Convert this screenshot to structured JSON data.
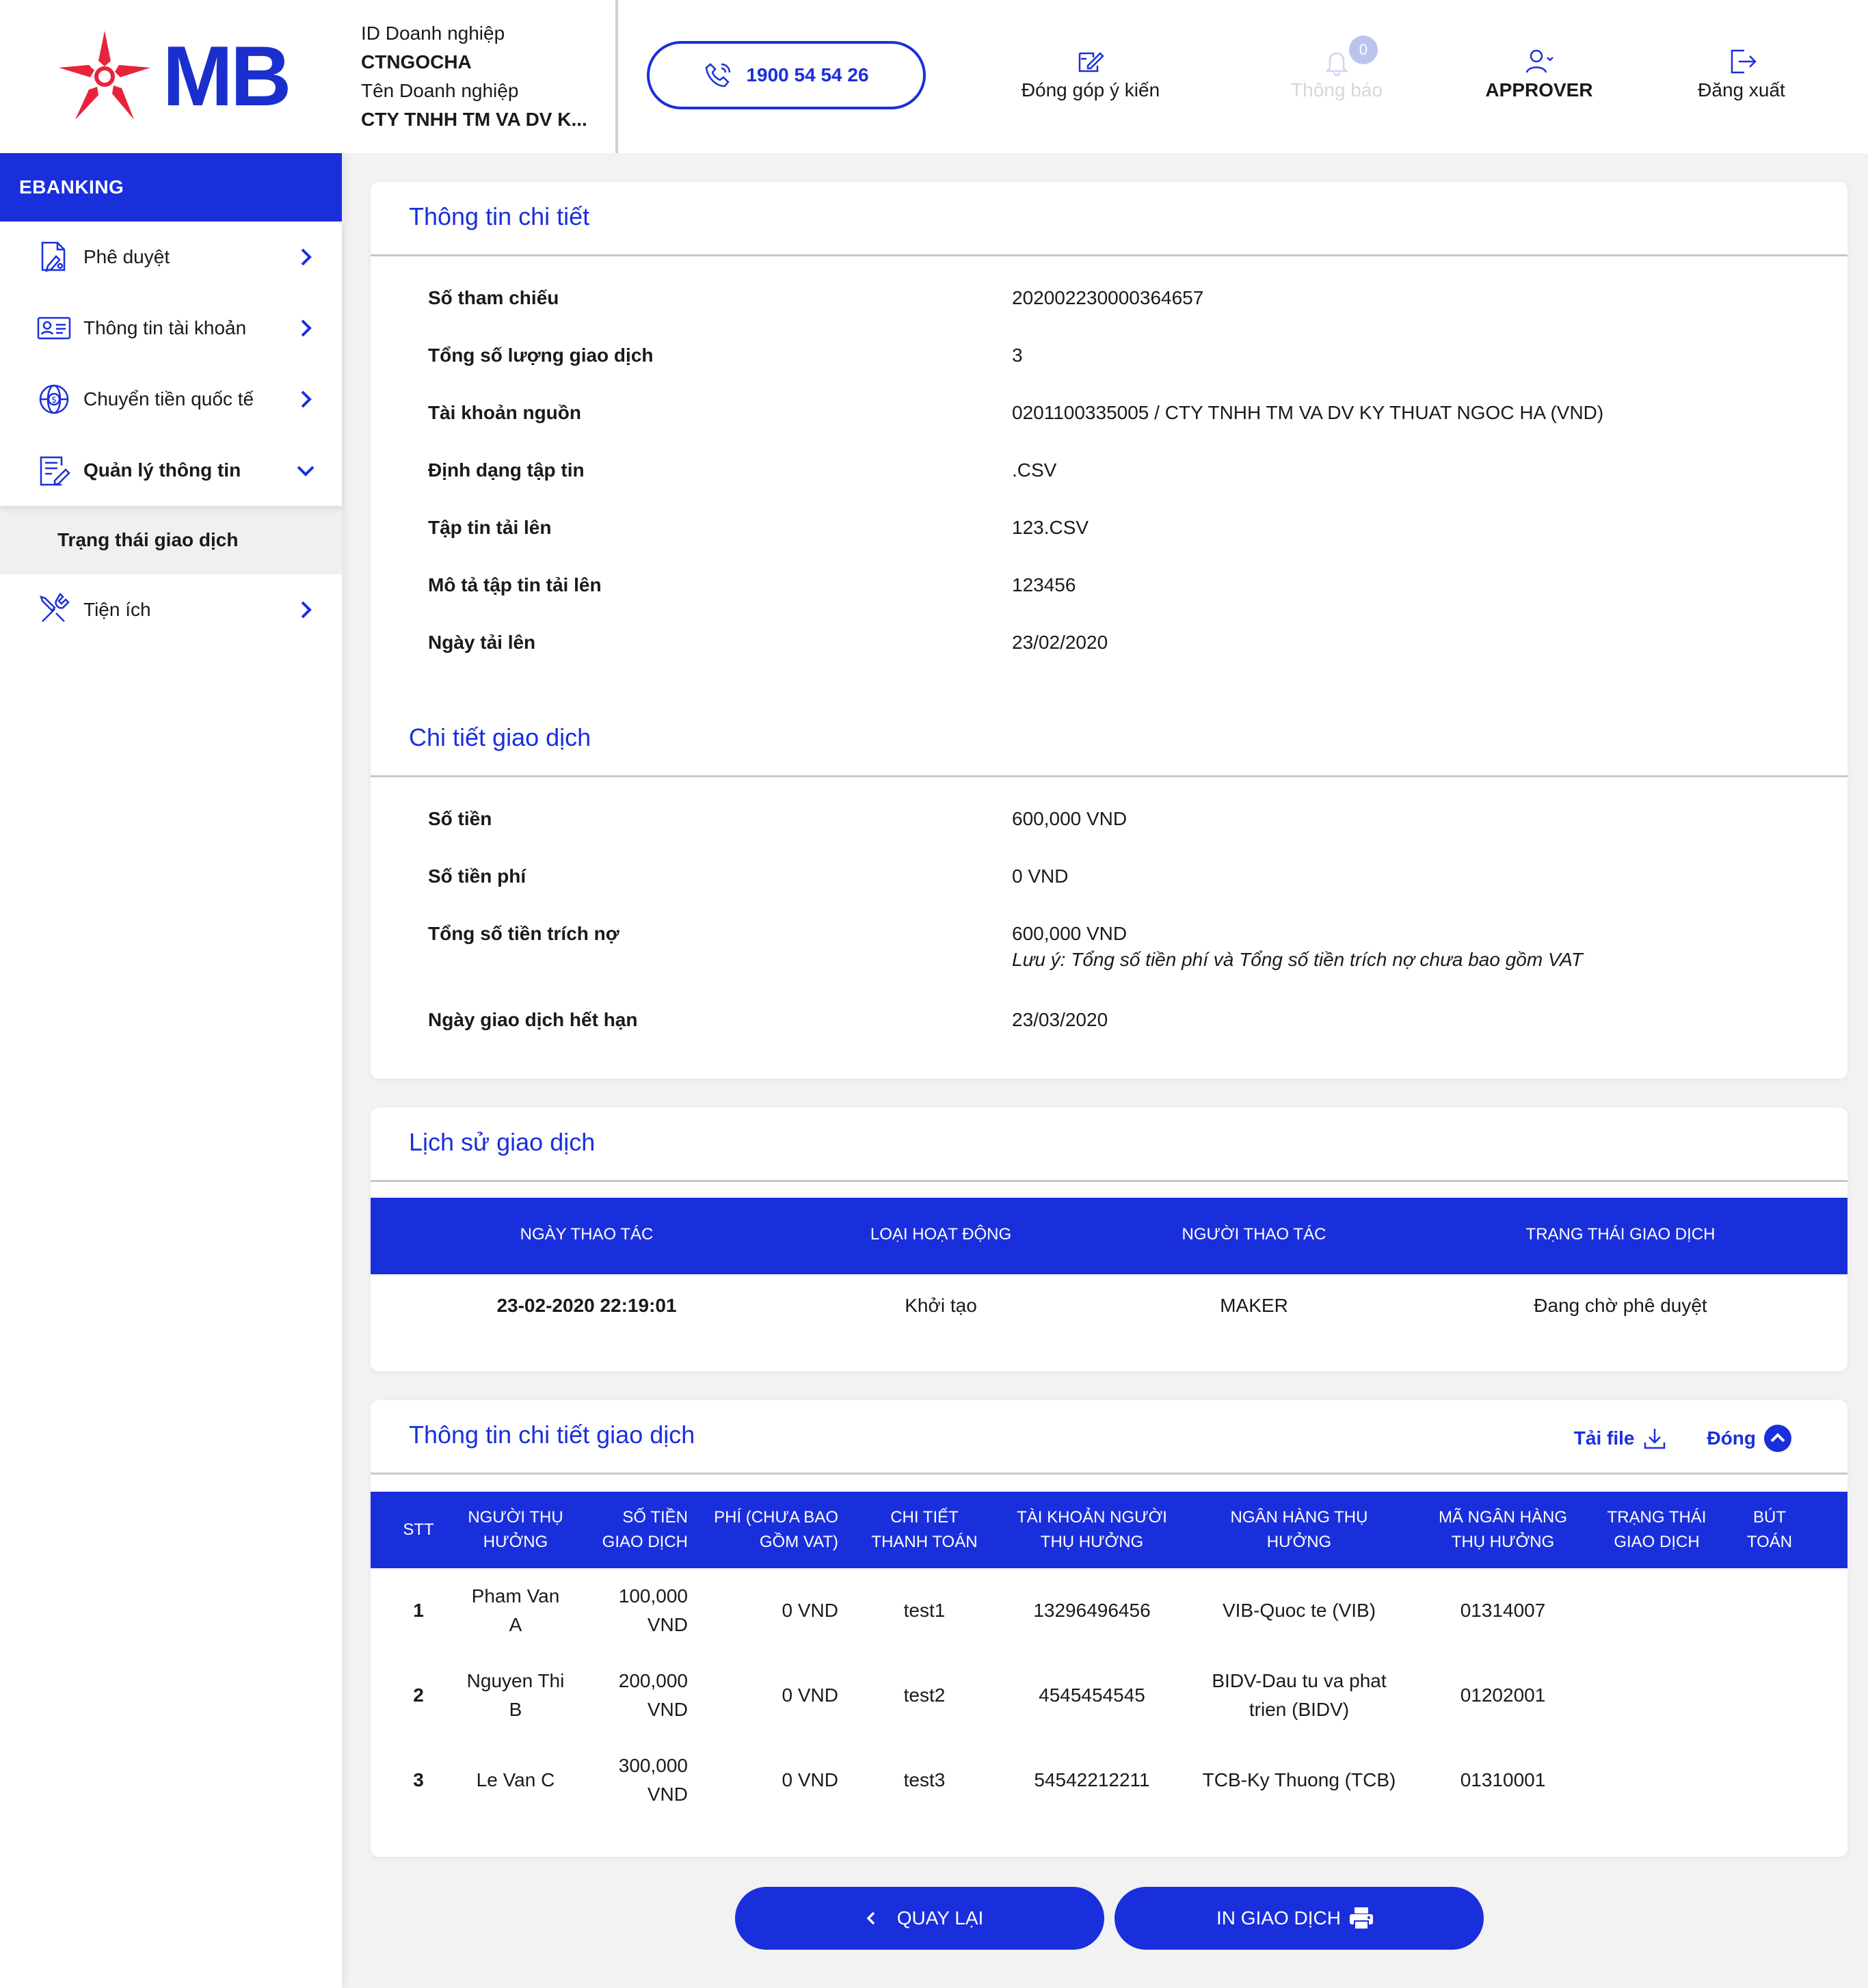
{
  "brand": {
    "name": "MB",
    "primary": "#1a2fdc",
    "logo_red": "#e8233c"
  },
  "company": {
    "id_label": "ID Doanh nghiệp",
    "id_value": "CTNGOCHA",
    "name_label": "Tên Doanh nghiệp",
    "name_value": "CTY TNHH TM VA DV K..."
  },
  "header": {
    "hotline": "1900 54 54 26",
    "feedback_label": "Đóng góp ý kiến",
    "notifications_label": "Thông báo",
    "notifications_count": "0",
    "user_label": "APPROVER",
    "logout_label": "Đăng xuất"
  },
  "sidebar": {
    "section": "EBANKING",
    "items": [
      {
        "label": "Phê duyệt",
        "icon": "approval-doc-icon"
      },
      {
        "label": "Thông tin tài khoản",
        "icon": "id-card-icon"
      },
      {
        "label": "Chuyển tiền quốc tế",
        "icon": "globe-dollar-icon"
      },
      {
        "label": "Quản lý thông tin",
        "icon": "doc-edit-icon",
        "expanded": true
      },
      {
        "label": "Trạng thái giao dịch",
        "sub": true
      },
      {
        "label": "Tiện ích",
        "icon": "tools-icon"
      }
    ]
  },
  "detail": {
    "title": "Thông tin chi tiết",
    "fields": [
      {
        "label": "Số tham chiếu",
        "value": "202002230000364657"
      },
      {
        "label": "Tổng số lượng giao dịch",
        "value": "3"
      },
      {
        "label": "Tài khoản nguồn",
        "value": "0201100335005 / CTY TNHH TM VA DV KY THUAT NGOC HA (VND)"
      },
      {
        "label": "Định dạng tập tin",
        "value": ".CSV"
      },
      {
        "label": "Tập tin tải lên",
        "value": "123.CSV"
      },
      {
        "label": "Mô tả tập tin tải lên",
        "value": "123456"
      },
      {
        "label": "Ngày tải lên",
        "value": "23/02/2020"
      }
    ],
    "tx_title": "Chi tiết giao dịch",
    "tx_fields": [
      {
        "label": "Số tiền",
        "value": "600,000 VND"
      },
      {
        "label": "Số tiền phí",
        "value": "0 VND"
      },
      {
        "label": "Tổng số tiền trích nợ",
        "value": "600,000 VND",
        "note": "Lưu ý: Tổng số tiền phí và Tổng số tiền trích nợ chưa bao gồm VAT"
      },
      {
        "label": "Ngày giao dịch hết hạn",
        "value": "23/03/2020"
      }
    ]
  },
  "history": {
    "title": "Lịch sử giao dịch",
    "columns": [
      "NGÀY THAO TÁC",
      "LOẠI HOẠT ĐỘNG",
      "NGƯỜI THAO TÁC",
      "TRẠNG THÁI GIAO DỊCH"
    ],
    "rows": [
      [
        "23-02-2020 22:19:01",
        "Khởi tạo",
        "MAKER",
        "Đang chờ phê duyệt"
      ]
    ]
  },
  "tx_detail": {
    "title": "Thông tin chi tiết giao dịch",
    "download_label": "Tải file",
    "close_label": "Đóng",
    "columns": [
      [
        "STT"
      ],
      [
        "NGƯỜI THỤ",
        "HƯỞNG"
      ],
      [
        "SỐ TIỀN",
        "GIAO DỊCH"
      ],
      [
        "PHÍ (CHƯA BAO",
        "GỒM VAT)"
      ],
      [
        "CHI TIẾT",
        "THANH TOÁN"
      ],
      [
        "TÀI KHOẢN NGƯỜI",
        "THỤ HƯỞNG"
      ],
      [
        "NGÂN HÀNG THỤ",
        "HƯỞNG"
      ],
      [
        "MÃ NGÂN HÀNG",
        "THỤ HƯỞNG"
      ],
      [
        "TRẠNG THÁI",
        "GIAO DỊCH"
      ],
      [
        "BÚT",
        "TOÁN"
      ]
    ],
    "rows": [
      {
        "stt": "1",
        "name": [
          "Pham Van",
          "A"
        ],
        "amount": [
          "100,000",
          "VND"
        ],
        "fee": "0 VND",
        "detail": "test1",
        "account": "13296496456",
        "bank": [
          "VIB-Quoc te (VIB)"
        ],
        "bank_code": "01314007",
        "status": "",
        "entry": ""
      },
      {
        "stt": "2",
        "name": [
          "Nguyen Thi",
          "B"
        ],
        "amount": [
          "200,000",
          "VND"
        ],
        "fee": "0 VND",
        "detail": "test2",
        "account": "4545454545",
        "bank": [
          "BIDV-Dau tu va phat",
          "trien (BIDV)"
        ],
        "bank_code": "01202001",
        "status": "",
        "entry": ""
      },
      {
        "stt": "3",
        "name": [
          "Le Van C"
        ],
        "amount": [
          "300,000",
          "VND"
        ],
        "fee": "0 VND",
        "detail": "test3",
        "account": "54542212211",
        "bank": [
          "TCB-Ky Thuong (TCB)"
        ],
        "bank_code": "01310001",
        "status": "",
        "entry": ""
      }
    ]
  },
  "buttons": {
    "back": "QUAY LẠI",
    "print": "IN GIAO DỊCH"
  }
}
